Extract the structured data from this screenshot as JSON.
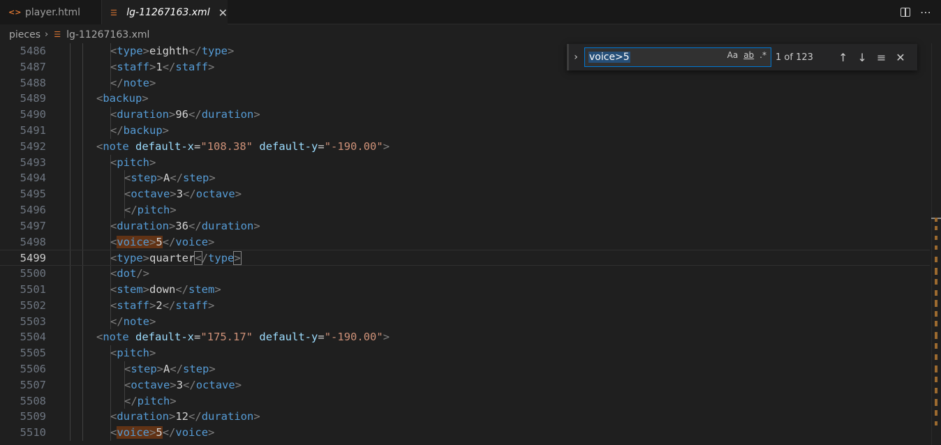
{
  "tabs": [
    {
      "label": "player.html",
      "icon": "html-code-icon",
      "active": false
    },
    {
      "label": "lg-11267163.xml",
      "icon": "rss-file-icon",
      "active": true
    }
  ],
  "breadcrumb": {
    "folder": "pieces",
    "file": "lg-11267163.xml"
  },
  "find": {
    "query": "voice>5",
    "count": "1 of 123",
    "opt_case": "Aa",
    "opt_word": "ab",
    "opt_regex": ".*"
  },
  "editor": {
    "current_line": "5499",
    "lines": [
      {
        "n": "5486",
        "indent": 2,
        "tokens": [
          [
            "p",
            "<"
          ],
          [
            "t",
            "type"
          ],
          [
            "p",
            ">"
          ],
          [
            "x",
            "eighth"
          ],
          [
            "p",
            "</"
          ],
          [
            "t",
            "type"
          ],
          [
            "p",
            ">"
          ]
        ]
      },
      {
        "n": "5487",
        "indent": 2,
        "tokens": [
          [
            "p",
            "<"
          ],
          [
            "t",
            "staff"
          ],
          [
            "p",
            ">"
          ],
          [
            "x",
            "1"
          ],
          [
            "p",
            "</"
          ],
          [
            "t",
            "staff"
          ],
          [
            "p",
            ">"
          ]
        ]
      },
      {
        "n": "5488",
        "indent": 2,
        "tokens": [
          [
            "p",
            "</"
          ],
          [
            "t",
            "note"
          ],
          [
            "p",
            ">"
          ]
        ]
      },
      {
        "n": "5489",
        "indent": 1,
        "tokens": [
          [
            "p",
            "<"
          ],
          [
            "t",
            "backup"
          ],
          [
            "p",
            ">"
          ]
        ]
      },
      {
        "n": "5490",
        "indent": 2,
        "tokens": [
          [
            "p",
            "<"
          ],
          [
            "t",
            "duration"
          ],
          [
            "p",
            ">"
          ],
          [
            "x",
            "96"
          ],
          [
            "p",
            "</"
          ],
          [
            "t",
            "duration"
          ],
          [
            "p",
            ">"
          ]
        ]
      },
      {
        "n": "5491",
        "indent": 2,
        "tokens": [
          [
            "p",
            "</"
          ],
          [
            "t",
            "backup"
          ],
          [
            "p",
            ">"
          ]
        ]
      },
      {
        "n": "5492",
        "indent": 1,
        "tokens": [
          [
            "p",
            "<"
          ],
          [
            "t",
            "note"
          ],
          [
            "x",
            " "
          ],
          [
            "a",
            "default-x"
          ],
          [
            "x",
            "="
          ],
          [
            "s",
            "\"108.38\""
          ],
          [
            "x",
            " "
          ],
          [
            "a",
            "default-y"
          ],
          [
            "x",
            "="
          ],
          [
            "s",
            "\"-190.00\""
          ],
          [
            "p",
            ">"
          ]
        ]
      },
      {
        "n": "5493",
        "indent": 2,
        "tokens": [
          [
            "p",
            "<"
          ],
          [
            "t",
            "pitch"
          ],
          [
            "p",
            ">"
          ]
        ]
      },
      {
        "n": "5494",
        "indent": 3,
        "tokens": [
          [
            "p",
            "<"
          ],
          [
            "t",
            "step"
          ],
          [
            "p",
            ">"
          ],
          [
            "x",
            "A"
          ],
          [
            "p",
            "</"
          ],
          [
            "t",
            "step"
          ],
          [
            "p",
            ">"
          ]
        ]
      },
      {
        "n": "5495",
        "indent": 3,
        "tokens": [
          [
            "p",
            "<"
          ],
          [
            "t",
            "octave"
          ],
          [
            "p",
            ">"
          ],
          [
            "x",
            "3"
          ],
          [
            "p",
            "</"
          ],
          [
            "t",
            "octave"
          ],
          [
            "p",
            ">"
          ]
        ]
      },
      {
        "n": "5496",
        "indent": 3,
        "tokens": [
          [
            "p",
            "</"
          ],
          [
            "t",
            "pitch"
          ],
          [
            "p",
            ">"
          ]
        ]
      },
      {
        "n": "5497",
        "indent": 2,
        "tokens": [
          [
            "p",
            "<"
          ],
          [
            "t",
            "duration"
          ],
          [
            "p",
            ">"
          ],
          [
            "x",
            "36"
          ],
          [
            "p",
            "</"
          ],
          [
            "t",
            "duration"
          ],
          [
            "p",
            ">"
          ]
        ]
      },
      {
        "n": "5498",
        "indent": 2,
        "tokens": [
          [
            "p",
            "<"
          ],
          [
            "th",
            "voice"
          ],
          [
            "ph",
            ">"
          ],
          [
            "xh",
            "5"
          ],
          [
            "p",
            "</"
          ],
          [
            "t",
            "voice"
          ],
          [
            "p",
            ">"
          ]
        ]
      },
      {
        "n": "5499",
        "indent": 2,
        "tokens": [
          [
            "p",
            "<"
          ],
          [
            "t",
            "type"
          ],
          [
            "p",
            ">"
          ],
          [
            "x",
            "quarter"
          ],
          [
            "pb",
            "<"
          ],
          [
            "p",
            "/"
          ],
          [
            "t",
            "type"
          ],
          [
            "pb",
            ">"
          ]
        ]
      },
      {
        "n": "5500",
        "indent": 2,
        "tokens": [
          [
            "p",
            "<"
          ],
          [
            "t",
            "dot"
          ],
          [
            "p",
            "/>"
          ]
        ]
      },
      {
        "n": "5501",
        "indent": 2,
        "tokens": [
          [
            "p",
            "<"
          ],
          [
            "t",
            "stem"
          ],
          [
            "p",
            ">"
          ],
          [
            "x",
            "down"
          ],
          [
            "p",
            "</"
          ],
          [
            "t",
            "stem"
          ],
          [
            "p",
            ">"
          ]
        ]
      },
      {
        "n": "5502",
        "indent": 2,
        "tokens": [
          [
            "p",
            "<"
          ],
          [
            "t",
            "staff"
          ],
          [
            "p",
            ">"
          ],
          [
            "x",
            "2"
          ],
          [
            "p",
            "</"
          ],
          [
            "t",
            "staff"
          ],
          [
            "p",
            ">"
          ]
        ]
      },
      {
        "n": "5503",
        "indent": 2,
        "tokens": [
          [
            "p",
            "</"
          ],
          [
            "t",
            "note"
          ],
          [
            "p",
            ">"
          ]
        ]
      },
      {
        "n": "5504",
        "indent": 1,
        "tokens": [
          [
            "p",
            "<"
          ],
          [
            "t",
            "note"
          ],
          [
            "x",
            " "
          ],
          [
            "a",
            "default-x"
          ],
          [
            "x",
            "="
          ],
          [
            "s",
            "\"175.17\""
          ],
          [
            "x",
            " "
          ],
          [
            "a",
            "default-y"
          ],
          [
            "x",
            "="
          ],
          [
            "s",
            "\"-190.00\""
          ],
          [
            "p",
            ">"
          ]
        ]
      },
      {
        "n": "5505",
        "indent": 2,
        "tokens": [
          [
            "p",
            "<"
          ],
          [
            "t",
            "pitch"
          ],
          [
            "p",
            ">"
          ]
        ]
      },
      {
        "n": "5506",
        "indent": 3,
        "tokens": [
          [
            "p",
            "<"
          ],
          [
            "t",
            "step"
          ],
          [
            "p",
            ">"
          ],
          [
            "x",
            "A"
          ],
          [
            "p",
            "</"
          ],
          [
            "t",
            "step"
          ],
          [
            "p",
            ">"
          ]
        ]
      },
      {
        "n": "5507",
        "indent": 3,
        "tokens": [
          [
            "p",
            "<"
          ],
          [
            "t",
            "octave"
          ],
          [
            "p",
            ">"
          ],
          [
            "x",
            "3"
          ],
          [
            "p",
            "</"
          ],
          [
            "t",
            "octave"
          ],
          [
            "p",
            ">"
          ]
        ]
      },
      {
        "n": "5508",
        "indent": 3,
        "tokens": [
          [
            "p",
            "</"
          ],
          [
            "t",
            "pitch"
          ],
          [
            "p",
            ">"
          ]
        ]
      },
      {
        "n": "5509",
        "indent": 2,
        "tokens": [
          [
            "p",
            "<"
          ],
          [
            "t",
            "duration"
          ],
          [
            "p",
            ">"
          ],
          [
            "x",
            "12"
          ],
          [
            "p",
            "</"
          ],
          [
            "t",
            "duration"
          ],
          [
            "p",
            ">"
          ]
        ]
      },
      {
        "n": "5510",
        "indent": 2,
        "tokens": [
          [
            "p",
            "<"
          ],
          [
            "th",
            "voice"
          ],
          [
            "ph",
            ">"
          ],
          [
            "xh",
            "5"
          ],
          [
            "p",
            "</"
          ],
          [
            "t",
            "voice"
          ],
          [
            "p",
            ">"
          ]
        ]
      }
    ]
  },
  "colors": {
    "background": "#1f1f1f",
    "tag": "#569cd6",
    "attribute": "#9cdcfe",
    "string": "#ce9178",
    "punctuation": "#808080",
    "match_highlight": "#623315",
    "find_border": "#0078d4"
  }
}
